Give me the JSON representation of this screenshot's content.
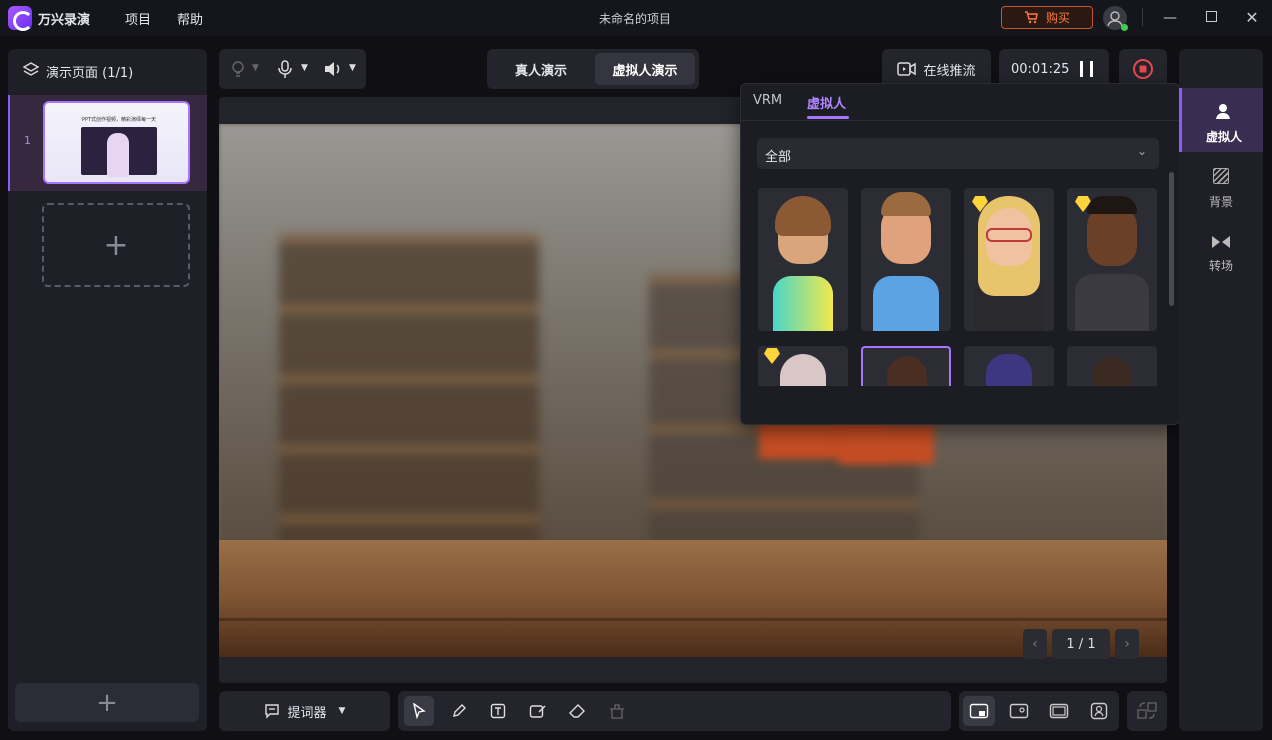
{
  "app": {
    "name": "万兴录演",
    "project_title": "未命名的项目"
  },
  "menu": {
    "items": [
      "项目",
      "帮助"
    ]
  },
  "titlebar": {
    "buy_label": "购买"
  },
  "left_panel": {
    "header": "演示页面 (1/1)",
    "slide_number": "1",
    "thumb_title": "PPT式创作视频，精彩演绎每一天"
  },
  "mode_tabs": {
    "real": "真人演示",
    "virtual": "虚拟人演示"
  },
  "toolbar": {
    "live_label": "在线推流",
    "timer": "00:01:25"
  },
  "avatar_panel": {
    "tabs": [
      "VRM",
      "虚拟人"
    ],
    "filter_value": "全部"
  },
  "canvas": {
    "page_indicator": "1 / 1"
  },
  "right_sidebar": {
    "items": [
      "虚拟人",
      "背景",
      "转场"
    ]
  },
  "bottom_toolbar": {
    "teleprompter_label": "提词器"
  },
  "colors": {
    "accent": "#8b5cf6",
    "premium_badge": "#ffd43b",
    "record": "#e5484d",
    "buy": "#ff7a3d"
  }
}
